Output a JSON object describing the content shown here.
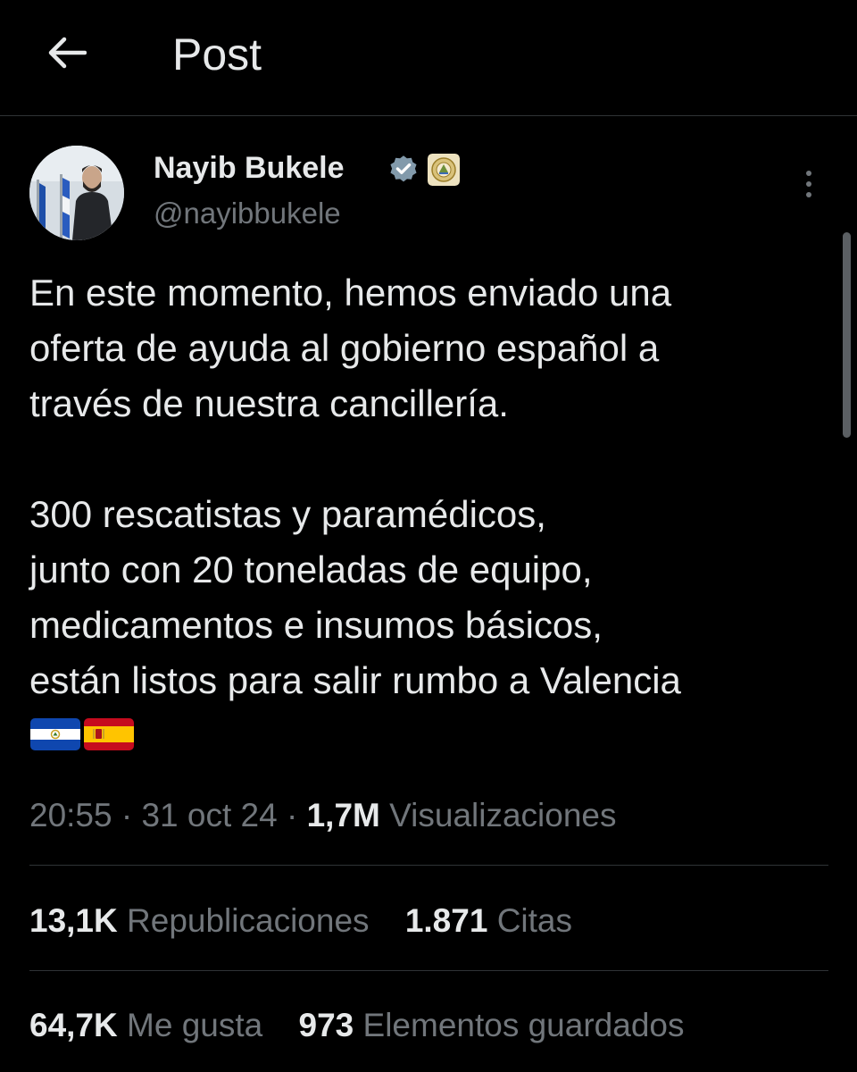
{
  "header": {
    "back_icon": "arrow-left-icon",
    "title": "Post"
  },
  "author": {
    "name": "Nayib Bukele",
    "handle": "@nayibbukele",
    "verified_icon": "verified-badge-icon",
    "verified_color": "#829aab",
    "affiliate_icon": "government-seal-icon",
    "more_icon": "more-vertical-icon"
  },
  "post": {
    "paragraph_1": "En este momento, hemos enviado una\noferta de ayuda al gobierno español a\ntravés de nuestra cancillería.",
    "paragraph_2": "300 rescatistas y paramédicos,\njunto con 20 toneladas de equipo,\nmedicamentos e insumos básicos,\nestán listos para salir rumbo a Valencia",
    "flags": [
      "🇸🇻",
      "🇪🇸"
    ],
    "flag_icons": [
      "el-salvador-flag-icon",
      "spain-flag-icon"
    ]
  },
  "meta": {
    "time": "20:55",
    "separator": "·",
    "date": "31 oct 24",
    "views_count": "1,7M",
    "views_label": "Visualizaciones"
  },
  "stats": {
    "reposts_count": "13,1K",
    "reposts_label": "Republicaciones",
    "quotes_count": "1.871",
    "quotes_label": "Citas",
    "likes_count": "64,7K",
    "likes_label": "Me gusta",
    "bookmarks_count": "973",
    "bookmarks_label": "Elementos guardados"
  },
  "colors": {
    "background": "#000000",
    "text_primary": "#e7e9ea",
    "text_secondary": "#71767b",
    "divider": "#2f3336"
  }
}
